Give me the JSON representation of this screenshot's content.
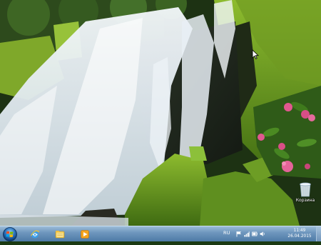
{
  "desktop": {
    "wallpaper": "waterfall-forest",
    "icons": [
      {
        "name": "recycle-bin",
        "label": "Корзина"
      }
    ]
  },
  "taskbar": {
    "pinned": [
      {
        "icon": "internet-explorer-icon"
      },
      {
        "icon": "windows-explorer-icon"
      },
      {
        "icon": "media-player-icon"
      }
    ],
    "language": "RU",
    "tray_icons": [
      "flag-icon",
      "network-icon",
      "battery-icon",
      "volume-icon"
    ],
    "clock": {
      "time": "11:49",
      "date": "26.04.2015"
    }
  },
  "colors": {
    "taskbar_top": "#9cbcd8",
    "taskbar_bottom": "#4d7aa6",
    "foliage": "#4f7f1e",
    "flower": "#e1588f"
  }
}
